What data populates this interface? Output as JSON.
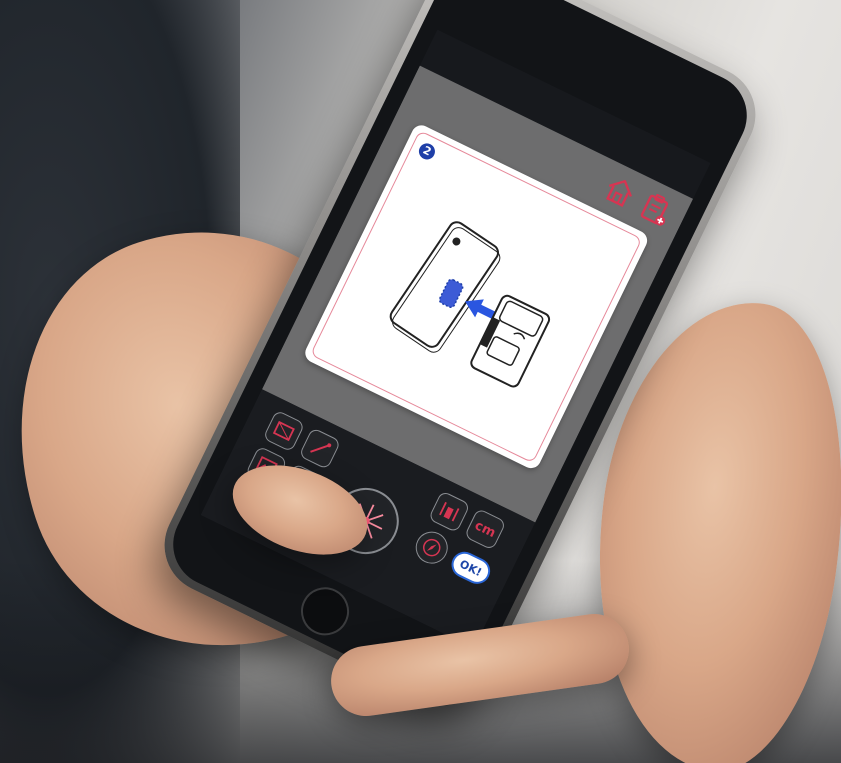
{
  "scene": {
    "description_colors": {
      "accent": "#d63552",
      "ok_border": "#2a66d6",
      "step_badge": "#1f3fa8",
      "screen_gray": "#6d6d6e"
    }
  },
  "app": {
    "top_icons": [
      "home-icon",
      "clipboard-icon"
    ],
    "card": {
      "step_number": "2"
    },
    "controls": {
      "unit_label": "cm",
      "ok_label": "OK!",
      "icons": [
        "frame-icon",
        "ruler-icon",
        "image-icon",
        "camera-icon",
        "laser-icon",
        "measure-icon",
        "compass-icon"
      ]
    }
  }
}
